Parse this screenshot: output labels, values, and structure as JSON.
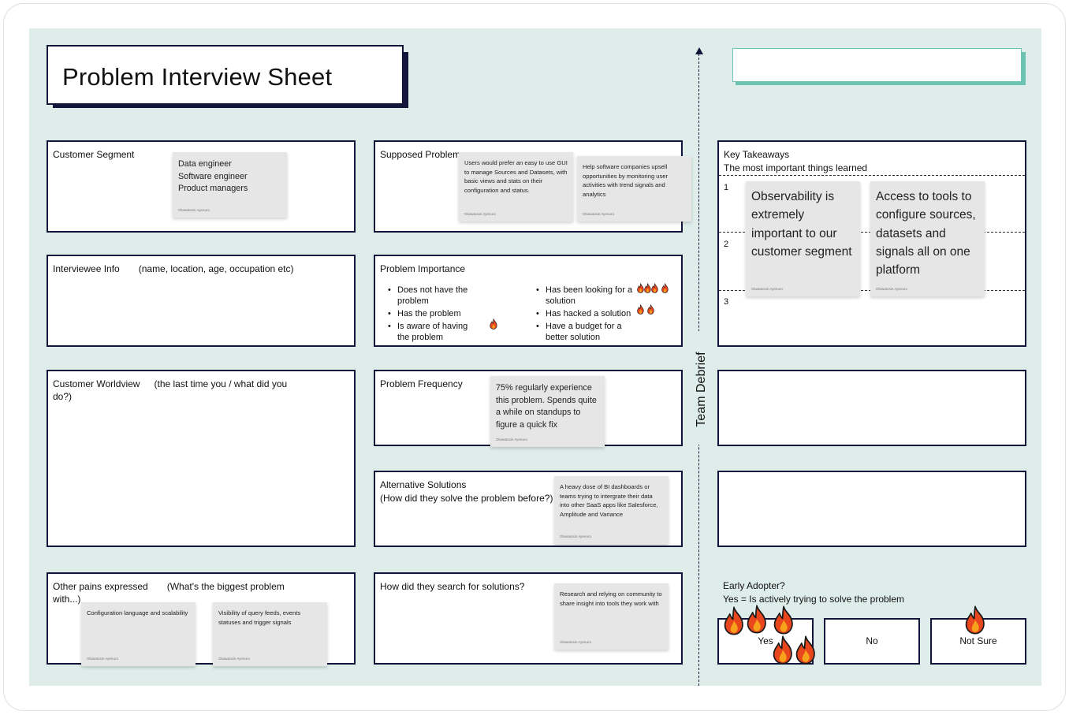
{
  "title": "Problem Interview Sheet",
  "customer_segment": {
    "title": "Customer Segment",
    "note": {
      "lines": [
        "Data engineer",
        "Software engineer",
        "Product managers"
      ],
      "author": "Oluwatosin Ayenuro"
    }
  },
  "interviewee_info": {
    "title": "Interviewee Info",
    "subtitle": "(name, location, age, occupation etc)"
  },
  "customer_worldview": {
    "title": "Customer Worldview",
    "subtitle": "(the last time you / what did you do?)"
  },
  "other_pains": {
    "title": "Other pains expressed",
    "subtitle": "(What's the biggest problem with...)",
    "notes": [
      {
        "text": "Configuration language and scalability",
        "author": "Oluwatosin Ayenuro"
      },
      {
        "text": "Visibility of query feeds, events statuses and trigger signals",
        "author": "Oluwatosin Ayenuro"
      }
    ]
  },
  "supposed_problem": {
    "title": "Supposed Problem",
    "notes": [
      {
        "text": "Users would prefer an easy to use GUI to manage Sources and Datasets, with basic views and stats on their configuration and status.",
        "author": "Oluwatosin Ayenuro"
      },
      {
        "text": "Help software companies upsell opportunities by monitoring user activities with trend signals and analytics",
        "author": "Oluwatosin Ayenuro"
      }
    ]
  },
  "problem_importance": {
    "title": "Problem Importance",
    "left_items": [
      {
        "label": "Does not have the problem",
        "votes": 0
      },
      {
        "label": "Has the problem",
        "votes": 0
      },
      {
        "label": "Is aware of having the problem",
        "votes": 1
      }
    ],
    "right_items": [
      {
        "label": "Has been looking for a solution",
        "votes": 4
      },
      {
        "label": "Has hacked a solution",
        "votes": 2
      },
      {
        "label": "Have a budget for a better solution",
        "votes": 0
      }
    ]
  },
  "problem_frequency": {
    "title": "Problem Frequency",
    "note": {
      "text": "75% regularly experience this problem. Spends quite a while on standups to figure a quick fix",
      "author": "Oluwatosin Ayenuro"
    }
  },
  "alternative_solutions": {
    "title": "Alternative Solutions",
    "subtitle": "(How did they solve the problem before?)",
    "note": {
      "text": "A heavy dose of BI dashboards or teams trying to intergrate their data into other SaaS apps like Salesforce, Amplitude and Variance",
      "author": "Oluwatosin Ayenuro"
    }
  },
  "search_solutions": {
    "title": "How did they search for solutions?",
    "note": {
      "text": "Research and relying on community to share insight into tools they work with",
      "author": "Oluwatosin Ayenuro"
    }
  },
  "team_debrief": {
    "label": "Team Debrief"
  },
  "key_takeaways": {
    "title": "Key Takeaways",
    "subtitle": "The most important things learned",
    "rows": [
      "1",
      "2",
      "3"
    ],
    "notes": [
      {
        "text": "Observability is extremely important to our customer segment",
        "author": "Oluwatosin Ayenuro"
      },
      {
        "text": "Access to tools to configure sources, datasets and signals all on one platform",
        "author": "Oluwatosin Ayenuro"
      }
    ]
  },
  "early_adopter": {
    "title": "Early Adopter?",
    "subtitle": "Yes = Is actively trying to solve the problem",
    "options": [
      {
        "label": "Yes",
        "votes": 5
      },
      {
        "label": "No",
        "votes": 0
      },
      {
        "label": "Not Sure",
        "votes": 1
      }
    ]
  },
  "colors": {
    "board": "#deedea",
    "border": "#13163a",
    "accent": "#6cc3b1",
    "note": "#e6e6e6",
    "flame": "#e8471e"
  },
  "icons": {
    "vote": "flame-icon",
    "arrow": "arrow-up-icon"
  }
}
